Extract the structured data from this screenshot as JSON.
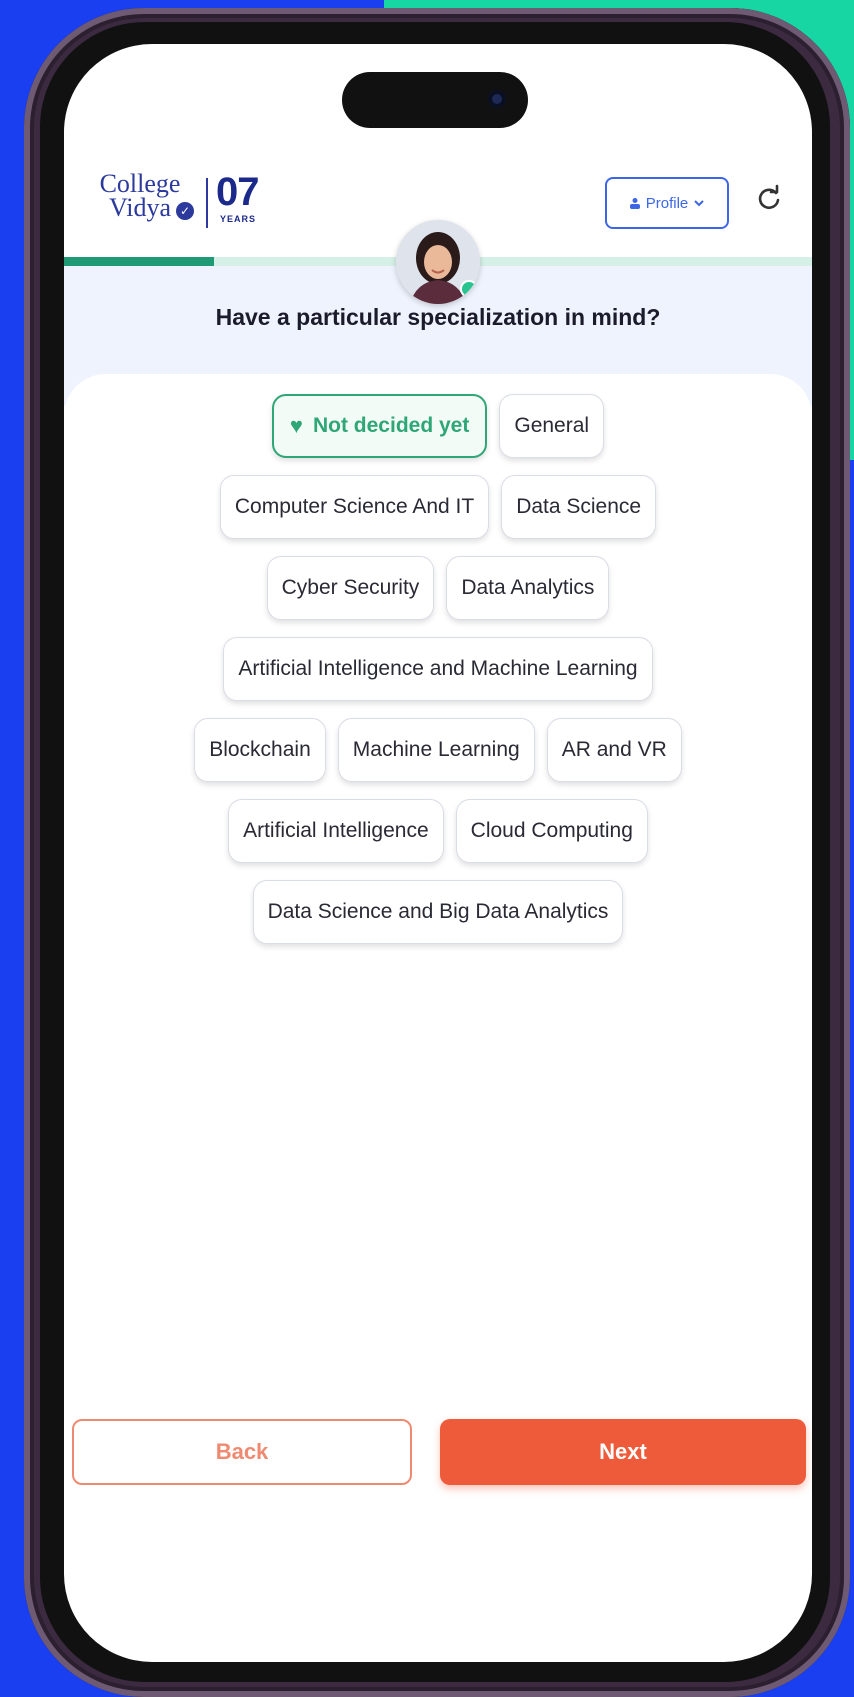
{
  "header": {
    "logo_line1": "College",
    "logo_line2": "Vidya",
    "years_number": "07",
    "years_label": "YEARS",
    "profile_label": "Profile",
    "progress_fraction": 0.2
  },
  "question": "Have a particular specialization in mind?",
  "chips": {
    "row1": [
      "Not decided yet",
      "General"
    ],
    "row2": [
      "Computer Science And IT",
      "Data Science"
    ],
    "row3": [
      "Cyber Security",
      "Data Analytics"
    ],
    "row4": [
      "Artificial Intelligence and Machine Learning"
    ],
    "row5": [
      "Blockchain",
      "Machine Learning",
      "AR and VR"
    ],
    "row6": [
      "Artificial Intelligence",
      "Cloud Computing"
    ],
    "row7": [
      "Data Science and Big Data Analytics"
    ]
  },
  "selected_chip": "Not decided yet",
  "buttons": {
    "back": "Back",
    "next": "Next"
  },
  "colors": {
    "accent_green": "#2ea676",
    "primary_orange": "#ee5b3a",
    "brand_blue": "#2b3a9c",
    "background_blue": "#1a3ff0",
    "background_teal": "#18d6a4"
  },
  "icons": [
    "profile-person-icon",
    "chevron-down-icon",
    "refresh-icon",
    "heart-icon",
    "check-badge-icon",
    "camera-icon"
  ]
}
